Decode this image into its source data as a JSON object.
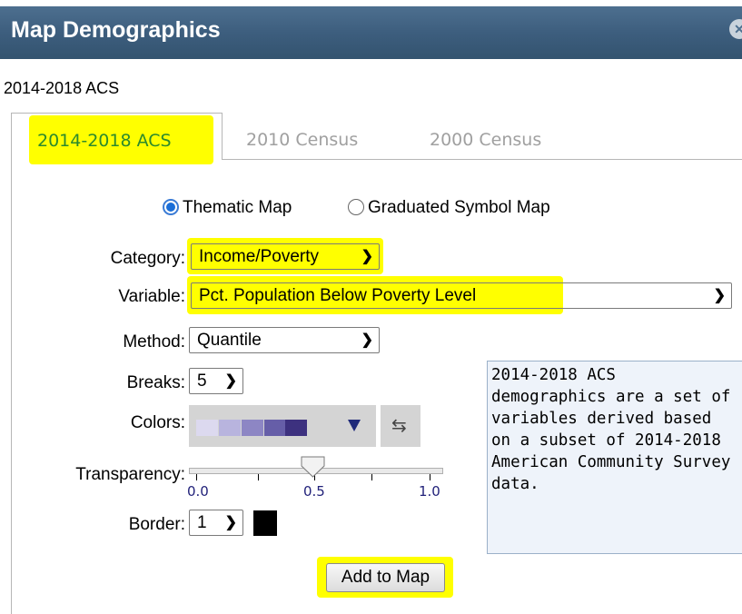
{
  "window": {
    "title": "Map Demographics"
  },
  "subtitle": "2014-2018 ACS",
  "tabs": [
    {
      "label": "2014-2018 ACS",
      "active": true
    },
    {
      "label": "2010 Census",
      "active": false
    },
    {
      "label": "2000 Census",
      "active": false
    }
  ],
  "map_type": {
    "options": [
      {
        "label": "Thematic Map",
        "selected": true
      },
      {
        "label": "Graduated Symbol Map",
        "selected": false
      }
    ]
  },
  "form": {
    "category": {
      "label": "Category:",
      "value": "Income/Poverty"
    },
    "variable": {
      "label": "Variable:",
      "value": "Pct. Population Below Poverty Level"
    },
    "method": {
      "label": "Method:",
      "value": "Quantile"
    },
    "breaks": {
      "label": "Breaks:",
      "value": "5"
    },
    "colors": {
      "label": "Colors:",
      "ramp": [
        "#dcd9ef",
        "#b8b4de",
        "#8d86c4",
        "#665ea8",
        "#3d317f"
      ]
    },
    "transparency": {
      "label": "Transparency:",
      "value": 0.5,
      "ticks": [
        "0.0",
        "0.5",
        "1.0"
      ]
    },
    "border": {
      "label": "Border:",
      "value": "1",
      "color": "#000000"
    }
  },
  "info_text": "2014-2018 ACS demographics are a set of variables derived based on a subset of 2014-2018 American Community Survey data.",
  "add_button": "Add to Map",
  "colors": {
    "titlebar": "#3d5e7e",
    "highlight": "#ffff00",
    "active_tab_text": "#2c8a2c"
  }
}
